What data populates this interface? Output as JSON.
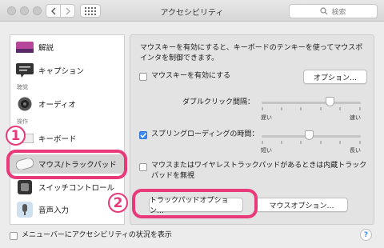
{
  "window": {
    "title": "アクセシビリティ"
  },
  "search": {
    "placeholder": "検索"
  },
  "sidebar": {
    "items": [
      {
        "label": "解説"
      },
      {
        "label": "キャプション"
      },
      {
        "label": "オーディオ"
      },
      {
        "label": "キーボード"
      },
      {
        "label": "マウス/トラックパッド"
      },
      {
        "label": "スイッチコントロール"
      },
      {
        "label": "音声入力"
      }
    ],
    "groups": [
      "聴覚",
      "操作"
    ]
  },
  "main": {
    "description": "マウスキーを有効にすると、キーボードのテンキーを使ってマウスポインタを制御できます。",
    "mousekeys_label": "マウスキーを有効にする",
    "options_button": "オプション…",
    "double_click_label": "ダブルクリック間隔：",
    "double_click_min": "遅い",
    "double_click_max": "速い",
    "double_click_value": 0.72,
    "spring_label": "スプリングローディングの時間：",
    "spring_min": "短い",
    "spring_max": "長い",
    "spring_value": 0.5,
    "spring_checked": true,
    "mousekeys_checked": false,
    "ignore_trackpad_label": "マウスまたはワイヤレストラックパッドがあるときは内蔵トラックパッドを無視",
    "ignore_checked": false,
    "trackpad_options_button": "トラックパッドオプション…",
    "mouse_options_button": "マウスオプション…"
  },
  "footer": {
    "menubar_status_label": "メニューバーにアクセシビリティの状況を表示",
    "help_label": "?"
  },
  "annotations": {
    "step1": "1",
    "step2": "2",
    "highlight_color": "#e83a7a"
  }
}
